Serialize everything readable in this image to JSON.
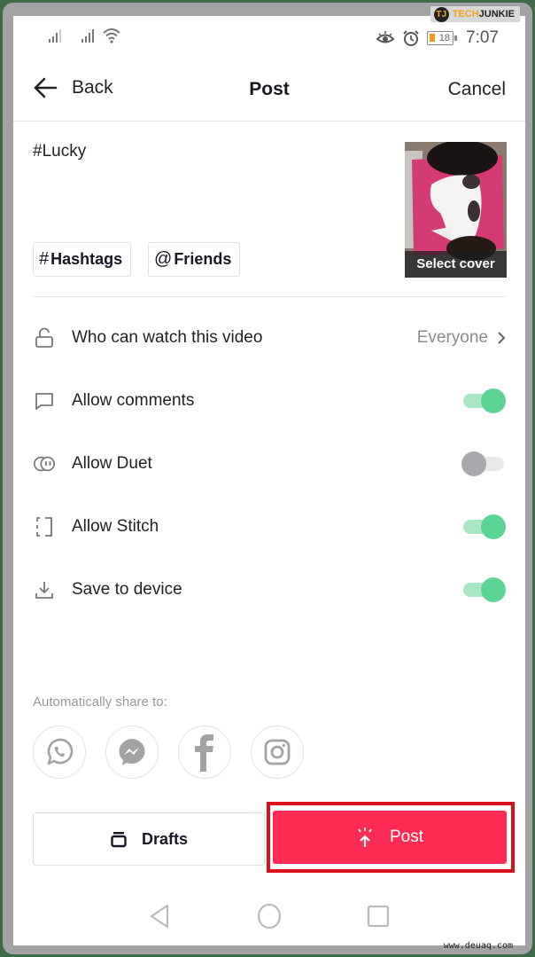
{
  "watermark": {
    "logo": "TJ",
    "brand_prefix": "TECH",
    "brand_suffix": "JUNKIE",
    "site": "www.deuaq.com"
  },
  "status_bar": {
    "icons": [
      "signal-sim1-icon",
      "signal-sim2-icon",
      "wifi-icon",
      "eye-comfort-icon",
      "alarm-icon"
    ],
    "battery_level": "18",
    "time": "7:07"
  },
  "header": {
    "back_label": "Back",
    "title": "Post",
    "cancel_label": "Cancel"
  },
  "caption": {
    "text": "#Lucky",
    "hashtags_chip": {
      "symbol": "#",
      "label": "Hashtags"
    },
    "friends_chip": {
      "symbol": "@",
      "label": "Friends"
    },
    "cover_label": "Select cover"
  },
  "settings": [
    {
      "icon": "lock-open-icon",
      "label": "Who can watch this video",
      "value": "Everyone",
      "type": "link"
    },
    {
      "icon": "comment-icon",
      "label": "Allow comments",
      "type": "toggle",
      "on": true
    },
    {
      "icon": "duet-icon",
      "label": "Allow Duet",
      "type": "toggle",
      "on": false
    },
    {
      "icon": "stitch-icon",
      "label": "Allow Stitch",
      "type": "toggle",
      "on": true
    },
    {
      "icon": "download-icon",
      "label": "Save to device",
      "type": "toggle",
      "on": true
    }
  ],
  "share": {
    "label": "Automatically share to:",
    "targets": [
      "whatsapp-icon",
      "messenger-icon",
      "facebook-icon",
      "instagram-icon"
    ]
  },
  "actions": {
    "drafts_label": "Drafts",
    "post_label": "Post"
  },
  "colors": {
    "accent": "#fe2c55",
    "toggle_on": "#5cd494",
    "highlight_border": "#d8101c"
  },
  "navbar": [
    "back-nav-icon",
    "home-nav-icon",
    "recents-nav-icon"
  ]
}
